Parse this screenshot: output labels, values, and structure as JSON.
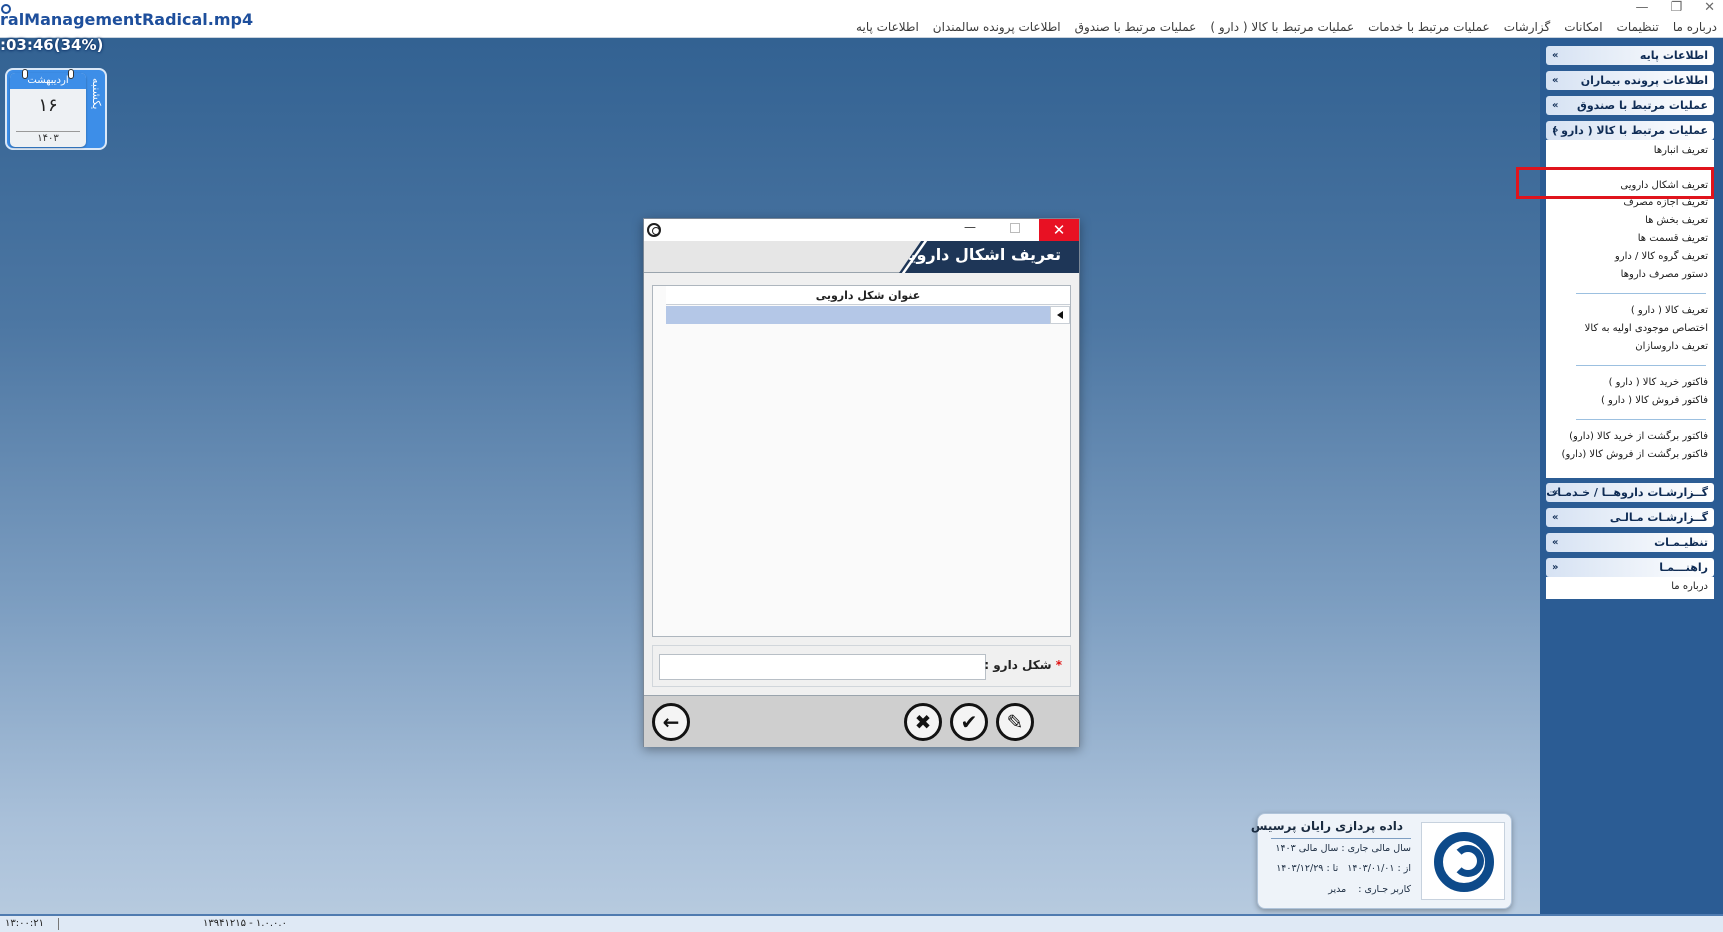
{
  "video": {
    "title": "ralManagementRadical.mp4",
    "time": ":03:46(34%)"
  },
  "window_controls": [
    "—",
    "❐",
    "✕"
  ],
  "menu": [
    "اطلاعات پایه",
    "اطلاعات پرونده سالمندان",
    "عملیات مرتبط با صندوق",
    "عملیات مرتبط با کالا ( دارو )",
    "عملیات مرتبط با خدمات",
    "گزارشات",
    "امکانات",
    "تنظیمات",
    "درباره ما"
  ],
  "calendar": {
    "month": "اردیبهشت",
    "day": "۱۶",
    "year": "۱۴۰۳",
    "weekday": "یکشنبه"
  },
  "sidebar": {
    "sections": [
      {
        "label": "اطلاعات پایه",
        "chevron": "»"
      },
      {
        "label": "اطلاعات پرونده بیماران",
        "chevron": "»"
      },
      {
        "label": "عملیات مرتبط با صندوق",
        "chevron": "»"
      },
      {
        "label": "عملیات مرتبط با کالا ( دارو )",
        "chevron": "«"
      },
      {
        "label": "گــزارشـات داروهــا / خـدمـات",
        "chevron": "»"
      },
      {
        "label": "گــزارشـات مـالـی",
        "chevron": "»"
      },
      {
        "label": "تنظیـمـات",
        "chevron": "»"
      },
      {
        "label": "راهنـــمـا",
        "chevron": "«"
      }
    ],
    "drug_items": [
      "تعریف انبارها",
      "تعریف اشکال دارویی",
      "تعریف اجازه مصرف",
      "تعریف بخش ها",
      "تعریف قسمت ها",
      "تعریف گروه کالا / دارو",
      "دستور مصرف داروها",
      "تعریف کالا ( دارو )",
      "اختصاص موجودی اولیه به کالا",
      "تعریف داروسازان",
      "فاکتور خرید کالا ( دارو )",
      "فاکتور فروش کالا ( دارو )",
      "فاکتور برگشت از خرید کالا (دارو)",
      "فاکتور برگشت از فروش کالا (دارو)"
    ],
    "help_items": [
      "درباره ما"
    ]
  },
  "dialog": {
    "min": "—",
    "close": "✕",
    "title": "تعریف اشکال دارویی",
    "grid_header": "عنوان شکل دارویی",
    "field_label": "شکل دارو :",
    "field_star": "*",
    "field_value": "",
    "buttons": {
      "back": "←",
      "cancel": "✖",
      "confirm": "✔",
      "edit": "✎"
    }
  },
  "company": {
    "name": "داده پردازی رایان پرسیس",
    "fiscal_label": "سال مالی جاری :",
    "fiscal_value": "سال مالی ۱۴۰۳",
    "from_label": "از :",
    "from_value": "۱۴۰۳/۰۱/۰۱",
    "to_label": "تا :",
    "to_value": "۱۴۰۳/۱۲/۲۹",
    "user_label": "کاربر جـاری :",
    "user_value": "مدیر"
  },
  "status": {
    "time": "۱۳:۰۰:۲۱",
    "version": "۱۳۹۴۱۲۱۵ - ۱.۰.۰.۰"
  },
  "colors": {
    "accent": "#2b5c94",
    "dialog_header": "#1e3657",
    "close_red": "#e81123",
    "highlight_red": "#e0141c",
    "grid_selected": "#b4c7e7"
  }
}
